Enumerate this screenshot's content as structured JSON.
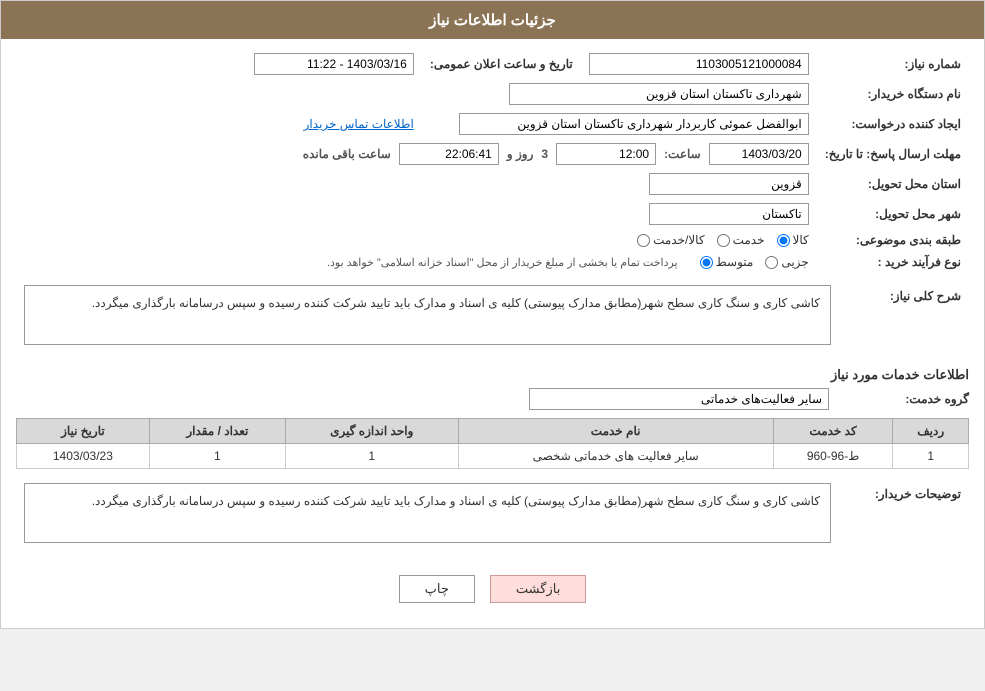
{
  "header": {
    "title": "جزئیات اطلاعات نیاز"
  },
  "fields": {
    "need_number_label": "شماره نیاز:",
    "need_number_value": "1103005121000084",
    "buyer_org_label": "نام دستگاه خریدار:",
    "buyer_org_value": "شهرداری تاکستان استان قزوین",
    "creator_label": "ایجاد کننده درخواست:",
    "creator_value": "ابوالفضل عموئی کاربردار شهرداری تاکستان استان قزوین",
    "contact_link": "اطلاعات تماس خریدار",
    "send_deadline_label": "مهلت ارسال پاسخ: تا تاریخ:",
    "date_value": "1403/03/20",
    "time_label": "ساعت:",
    "time_value": "12:00",
    "days_label": "روز و",
    "days_value": "3",
    "remaining_label": "ساعت باقی مانده",
    "remaining_value": "22:06:41",
    "announce_label": "تاریخ و ساعت اعلان عمومی:",
    "announce_value": "1403/03/16 - 11:22",
    "province_label": "استان محل تحویل:",
    "province_value": "قزوین",
    "city_label": "شهر محل تحویل:",
    "city_value": "تاکستان",
    "category_label": "طبقه بندی موضوعی:",
    "category_options": [
      "کالا",
      "خدمت",
      "کالا/خدمت"
    ],
    "category_selected": "کالا",
    "process_label": "نوع فرآیند خرید :",
    "process_options": [
      "جزیی",
      "متوسط"
    ],
    "process_note": "پرداخت تمام یا بخشی از مبلغ خریدار از محل \"اسناد خزانه اسلامی\" خواهد بود.",
    "general_desc_label": "شرح کلی نیاز:",
    "general_desc_value": "کاشی کاری و سنگ کاری سطح شهر(مطابق مدارک پیوستی) کلیه ی اسناد و مدارک باید تایید شرکت کننده رسیده و سپس درسامانه بارگذاری میگردد."
  },
  "services_info": {
    "title": "اطلاعات خدمات مورد نیاز",
    "group_label": "گروه خدمت:",
    "group_value": "سایر فعالیت‌های خدماتی",
    "table": {
      "headers": [
        "ردیف",
        "کد خدمت",
        "نام خدمت",
        "واحد اندازه گیری",
        "تعداد / مقدار",
        "تاریخ نیاز"
      ],
      "rows": [
        {
          "row": "1",
          "code": "ط-96-960",
          "name": "سایر فعالیت های خدماتی شخصی",
          "unit": "1",
          "quantity": "1",
          "date": "1403/03/23"
        }
      ]
    }
  },
  "buyer_notes": {
    "label": "توضیحات خریدار:",
    "value": "کاشی کاری و سنگ کاری سطح شهر(مطابق مدارک پیوستی) کلیه ی اسناد و مدارک باید تایید شرکت کننده رسیده و سپس درسامانه بارگذاری میگردد."
  },
  "buttons": {
    "print": "چاپ",
    "back": "بازگشت"
  }
}
